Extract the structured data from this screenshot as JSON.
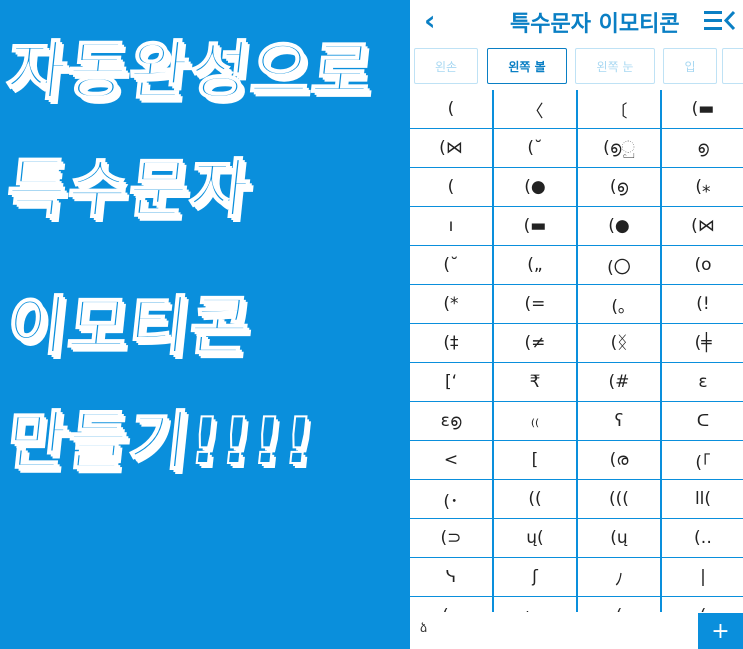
{
  "promo": {
    "line1": "자동완성으로",
    "line2": "특수문자",
    "line3": "이모티콘",
    "line4": "만들기!!!!"
  },
  "header": {
    "back_icon": "chevron-left-icon",
    "title": "특수문자 이모티콘",
    "menu_icon": "menu-arrow-icon"
  },
  "tabs": [
    {
      "label": "왼손",
      "active": false
    },
    {
      "label": "왼쪽 볼",
      "active": true
    },
    {
      "label": "왼쪽 눈",
      "active": false
    },
    {
      "label": "입",
      "active": false
    },
    {
      "label": "",
      "active": false
    }
  ],
  "grid": [
    [
      "(",
      "〈",
      "〔",
      "(▬"
    ],
    [
      "(⋈",
      "(˘",
      "(൭ු",
      "൭"
    ],
    [
      "(",
      "(●",
      "(൭",
      "(⁎"
    ],
    [
      "ı",
      "(▬",
      "(●",
      "(⋈"
    ],
    [
      "(˘",
      "(„",
      "(〇",
      "(o"
    ],
    [
      "(*",
      "(=",
      "(｡",
      "(!"
    ],
    [
      "(‡",
      "(≠",
      "(ᛝ",
      "(╪"
    ],
    [
      "[ʻ",
      "₹",
      "(#",
      "ɛ"
    ],
    [
      "ɛ൭",
      "₍₍",
      "ʕ",
      "ᑕ"
    ],
    [
      "<",
      "[",
      "(ര",
      "(「"
    ],
    [
      "(･",
      "((",
      "(((",
      "ll("
    ],
    [
      "(⊃",
      "ų(",
      "(ų",
      "(‥"
    ],
    [
      "ᓭ",
      "ʃ",
      "ﾉ",
      "|"
    ],
    [
      "(‥",
      "(ヽ",
      "(",
      "("
    ]
  ],
  "bottombar": {
    "input_text": "ձ",
    "add_label": "+"
  },
  "colors": {
    "brand_blue": "#0a8fdc",
    "title_blue": "#0a7fc4"
  }
}
